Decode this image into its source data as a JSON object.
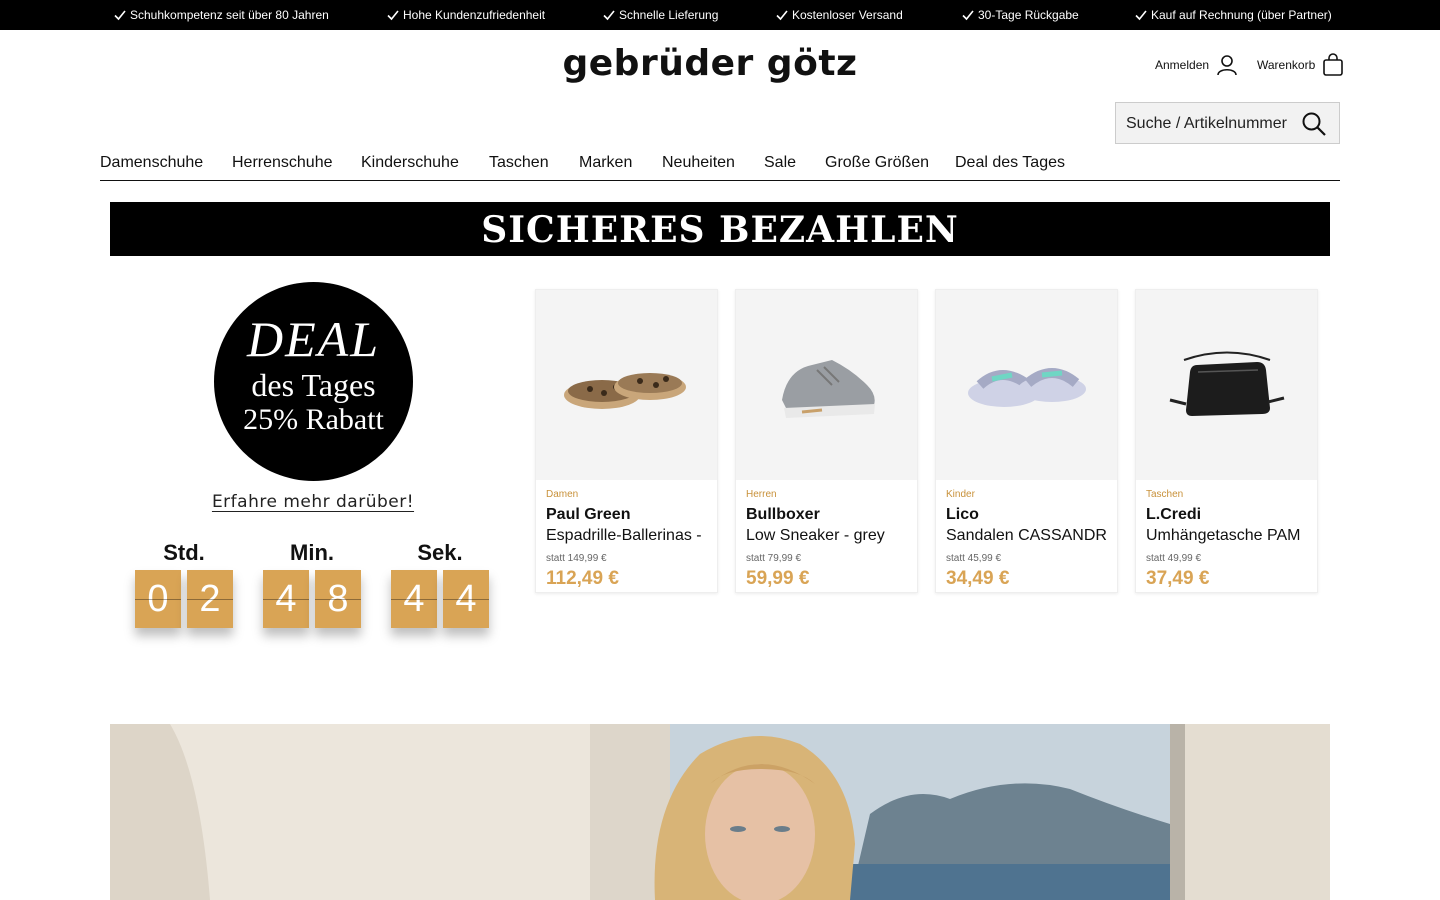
{
  "usp_bar": {
    "items": [
      "Schuhkompetenz seit über 80 Jahren",
      "Hohe Kundenzufriedenheit",
      "Schnelle Lieferung",
      "Kostenloser Versand",
      "30-Tage Rückgabe",
      "Kauf auf Rechnung (über Partner)"
    ]
  },
  "header": {
    "logo": "gebrüder götz",
    "login_label": "Anmelden",
    "cart_label": "Warenkorb",
    "search_placeholder": "Suche / Artikelnummer"
  },
  "nav": {
    "items": [
      "Damenschuhe",
      "Herrenschuhe",
      "Kinderschuhe",
      "Taschen",
      "Marken",
      "Neuheiten",
      "Sale",
      "Große Größen",
      "Deal des Tages"
    ]
  },
  "banner": {
    "text": "SICHERES BEZAHLEN"
  },
  "deal": {
    "line1": "DEAL",
    "line2": "des Tages",
    "line3": "25% Rabatt",
    "learn_more": "Erfahre mehr darüber!"
  },
  "countdown": {
    "hours_label": "Std.",
    "minutes_label": "Min.",
    "seconds_label": "Sek.",
    "hours": [
      "0",
      "2"
    ],
    "minutes": [
      "4",
      "8"
    ],
    "seconds": [
      "4",
      "4"
    ]
  },
  "products": [
    {
      "category": "Damen",
      "brand": "Paul Green",
      "name": "Espadrille-Ballerinas -",
      "old_price": "statt 149,99 €",
      "price": "112,49 €",
      "icon": "espadrille-icon"
    },
    {
      "category": "Herren",
      "brand": "Bullboxer",
      "name": "Low Sneaker - grey",
      "old_price": "statt 79,99 €",
      "price": "59,99 €",
      "icon": "sneaker-icon"
    },
    {
      "category": "Kinder",
      "brand": "Lico",
      "name": "Sandalen CASSANDR",
      "old_price": "statt 45,99 €",
      "price": "34,49 €",
      "icon": "sandal-icon"
    },
    {
      "category": "Taschen",
      "brand": "L.Credi",
      "name": "Umhängetasche PAM",
      "old_price": "statt 49,99 €",
      "price": "37,49 €",
      "icon": "bag-icon"
    }
  ],
  "colors": {
    "accent_gold": "#d9a455",
    "category_gold": "#c8913a",
    "black": "#000000"
  }
}
